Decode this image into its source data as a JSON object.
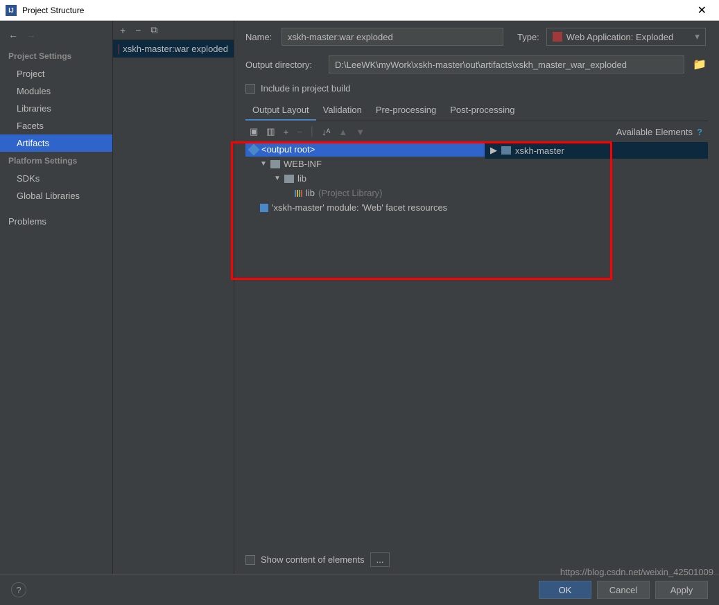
{
  "window": {
    "title": "Project Structure",
    "close": "✕"
  },
  "nav": {
    "back": "←",
    "forward": "→"
  },
  "sidebar": {
    "sections": [
      {
        "header": "Project Settings",
        "items": [
          {
            "label": "Project"
          },
          {
            "label": "Modules"
          },
          {
            "label": "Libraries"
          },
          {
            "label": "Facets"
          },
          {
            "label": "Artifacts",
            "selected": true
          }
        ]
      },
      {
        "header": "Platform Settings",
        "items": [
          {
            "label": "SDKs"
          },
          {
            "label": "Global Libraries"
          }
        ]
      }
    ],
    "problems": "Problems"
  },
  "middle": {
    "toolbar": {
      "add": "+",
      "remove": "−",
      "copy": "⧉"
    },
    "artifact": "xskh-master:war exploded"
  },
  "form": {
    "name_label": "Name:",
    "name_value": "xskh-master:war exploded",
    "type_label": "Type:",
    "type_value": "Web Application: Exploded",
    "output_dir_label": "Output directory:",
    "output_dir_value": "D:\\LeeWK\\myWork\\xskh-master\\out\\artifacts\\xskh_master_war_exploded",
    "include_label": "Include in project build"
  },
  "tabs": [
    {
      "label": "Output Layout",
      "active": true
    },
    {
      "label": "Validation"
    },
    {
      "label": "Pre-processing"
    },
    {
      "label": "Post-processing"
    }
  ],
  "layout_toolbar": {
    "newfolder": "▣",
    "col": "▥",
    "add": "+",
    "remove": "−",
    "sort": "↓ᴬ",
    "up": "▲",
    "down": "▼"
  },
  "tree": {
    "root": "<output root>",
    "webinf": "WEB-INF",
    "lib": "lib",
    "lib_item": "lib",
    "lib_hint": "(Project Library)",
    "facet": "'xskh-master' module: 'Web' facet resources"
  },
  "available": {
    "header": "Available Elements",
    "help": "?",
    "item": "xskh-master"
  },
  "bottom": {
    "show_content": "Show content of elements",
    "dots": "..."
  },
  "footer": {
    "help": "?",
    "ok": "OK",
    "cancel": "Cancel",
    "apply": "Apply"
  },
  "watermark": "https://blog.csdn.net/weixin_42501009"
}
